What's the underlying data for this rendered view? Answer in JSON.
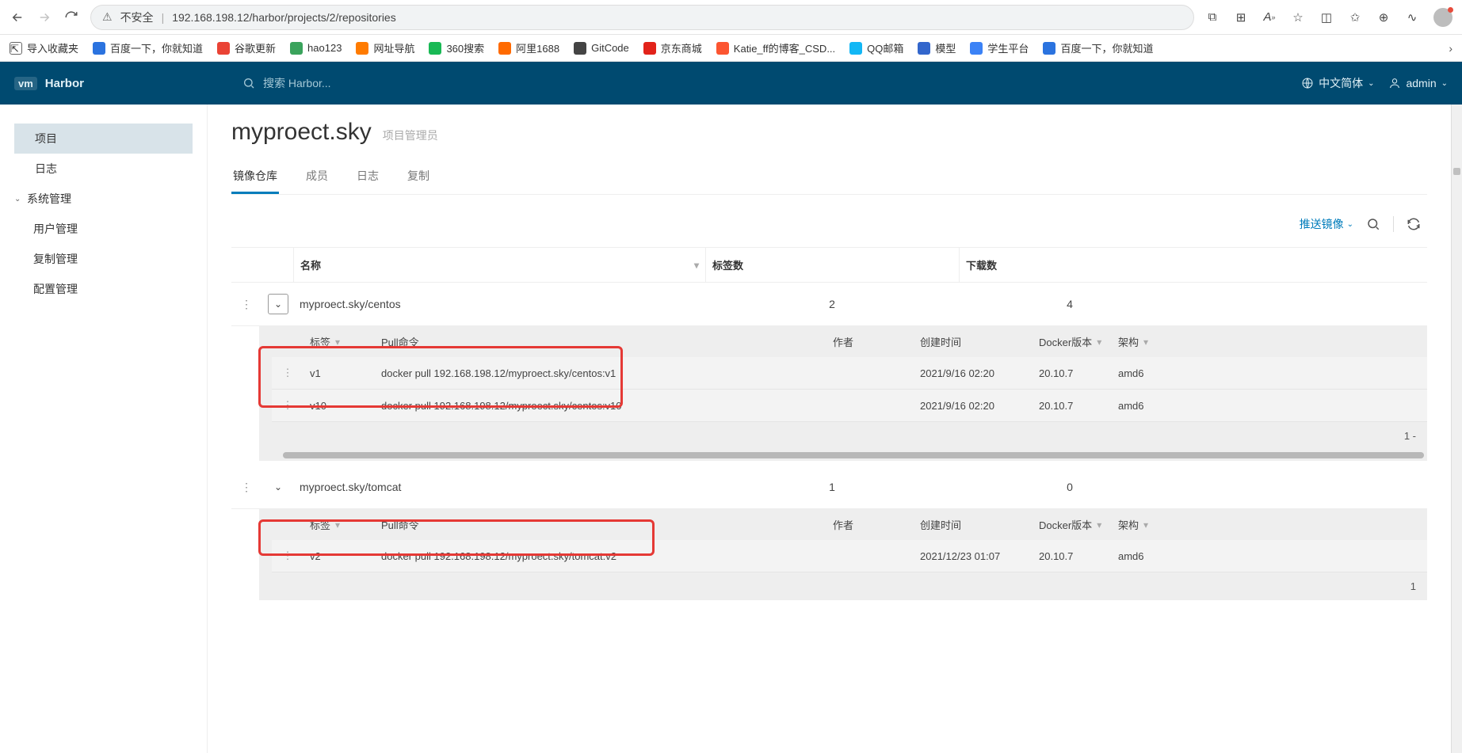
{
  "browser": {
    "insecure_label": "不安全",
    "url": "192.168.198.12/harbor/projects/2/repositories"
  },
  "bookmarks": {
    "import": "导入收藏夹",
    "items": [
      {
        "label": "百度一下，你就知道",
        "color": "#2b73df"
      },
      {
        "label": "谷歌更新",
        "color": "#ea4335"
      },
      {
        "label": "hao123",
        "color": "#3aa35c"
      },
      {
        "label": "网址导航",
        "color": "#ff7b00"
      },
      {
        "label": "360搜索",
        "color": "#19b955"
      },
      {
        "label": "阿里1688",
        "color": "#ff6a00"
      },
      {
        "label": "GitCode",
        "color": "#444"
      },
      {
        "label": "京东商城",
        "color": "#e2231a"
      },
      {
        "label": "Katie_ff的博客_CSD...",
        "color": "#fc5531"
      },
      {
        "label": "QQ邮箱",
        "color": "#12b7f5"
      },
      {
        "label": "模型",
        "color": "#3366cc"
      },
      {
        "label": "学生平台",
        "color": "#3b82f6"
      },
      {
        "label": "百度一下，你就知道",
        "color": "#2b73df"
      }
    ]
  },
  "header": {
    "brand": "Harbor",
    "search_placeholder": "搜索 Harbor...",
    "language": "中文简体",
    "user": "admin"
  },
  "sidebar": {
    "project": "项目",
    "log": "日志",
    "sys_admin": "系统管理",
    "user_mgmt": "用户管理",
    "replication": "复制管理",
    "config": "配置管理"
  },
  "project": {
    "name": "myproect.sky",
    "role": "项目管理员"
  },
  "tabs": {
    "repo": "镜像仓库",
    "members": "成员",
    "logs": "日志",
    "replication": "复制"
  },
  "toolbar": {
    "push": "推送镜像"
  },
  "columns": {
    "name": "名称",
    "tags": "标签数",
    "pulls": "下载数"
  },
  "tag_columns": {
    "tag": "标签",
    "pull_cmd": "Pull命令",
    "author": "作者",
    "created": "创建时间",
    "docker_ver": "Docker版本",
    "arch": "架构"
  },
  "repos": [
    {
      "name": "myproect.sky/centos",
      "tag_count": "2",
      "pull_count": "4",
      "tags": [
        {
          "tag": "v1",
          "cmd": "docker pull 192.168.198.12/myproect.sky/centos:v1",
          "author": "",
          "created": "2021/9/16 02:20",
          "docker": "20.10.7",
          "arch": "amd6"
        },
        {
          "tag": "v10",
          "cmd": "docker pull 192.168.198.12/myproect.sky/centos:v10",
          "author": "",
          "created": "2021/9/16 02:20",
          "docker": "20.10.7",
          "arch": "amd6"
        }
      ],
      "footer": "1 -"
    },
    {
      "name": "myproect.sky/tomcat",
      "tag_count": "1",
      "pull_count": "0",
      "tags": [
        {
          "tag": "v2",
          "cmd": "docker pull 192.168.198.12/myproect.sky/tomcat:v2",
          "author": "",
          "created": "2021/12/23 01:07",
          "docker": "20.10.7",
          "arch": "amd6"
        }
      ],
      "footer": "1"
    }
  ]
}
